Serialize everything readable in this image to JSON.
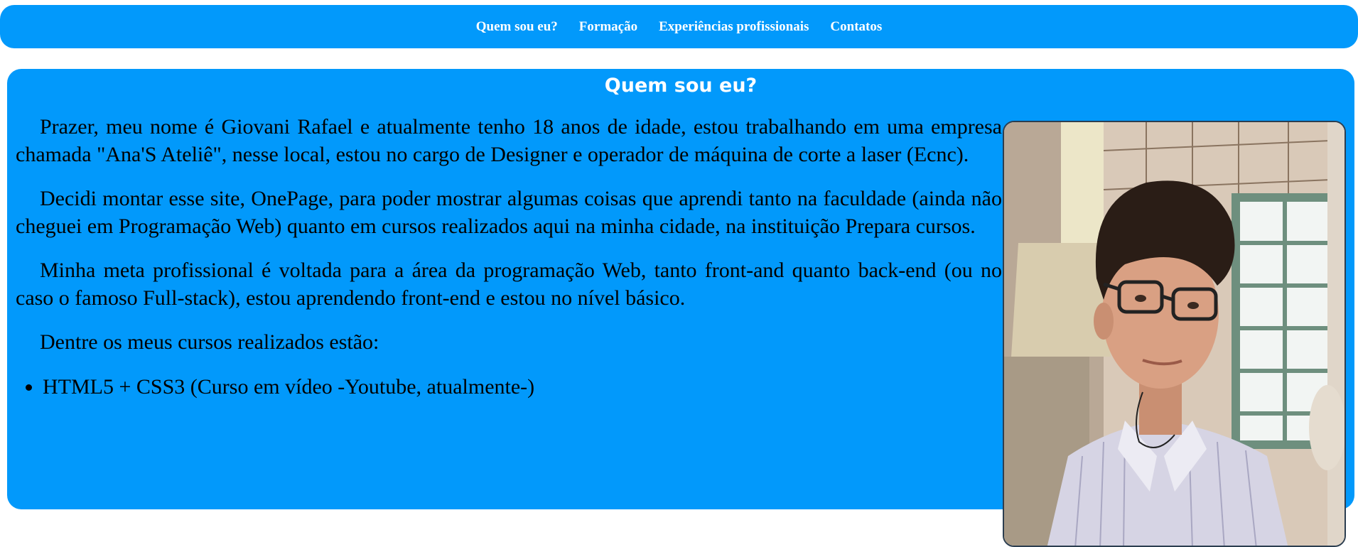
{
  "nav": {
    "items": [
      {
        "label": "Quem sou eu?"
      },
      {
        "label": "Formação"
      },
      {
        "label": "Experiências profissionais"
      },
      {
        "label": "Contatos"
      }
    ]
  },
  "section": {
    "title": "Quem sou eu?",
    "paragraphs": [
      "Prazer, meu nome é Giovani Rafael e atualmente tenho 18 anos de idade, estou trabalhando em uma empresa chamada \"Ana'S Ateliê\", nesse local, estou no cargo de Designer e operador de máquina de corte a laser (Ecnc).",
      "Decidi montar esse site, OnePage, para poder mostrar algumas coisas que aprendi tanto na faculdade (ainda não cheguei em Programação Web) quanto em cursos realizados aqui na minha cidade, na instituição Prepara cursos.",
      "Minha meta profissional é voltada para a área da programação Web, tanto front-and quanto back-end (ou no caso o famoso Full-stack), estou aprendendo front-end e estou no nível básico.",
      "Dentre os meus cursos realizados estão:"
    ],
    "courses": [
      "HTML5 + CSS3 (Curso em vídeo -Youtube, atualmente-)"
    ]
  },
  "colors": {
    "primary": "#0299fb",
    "text": "#000000",
    "nav_text": "#ffffff"
  }
}
